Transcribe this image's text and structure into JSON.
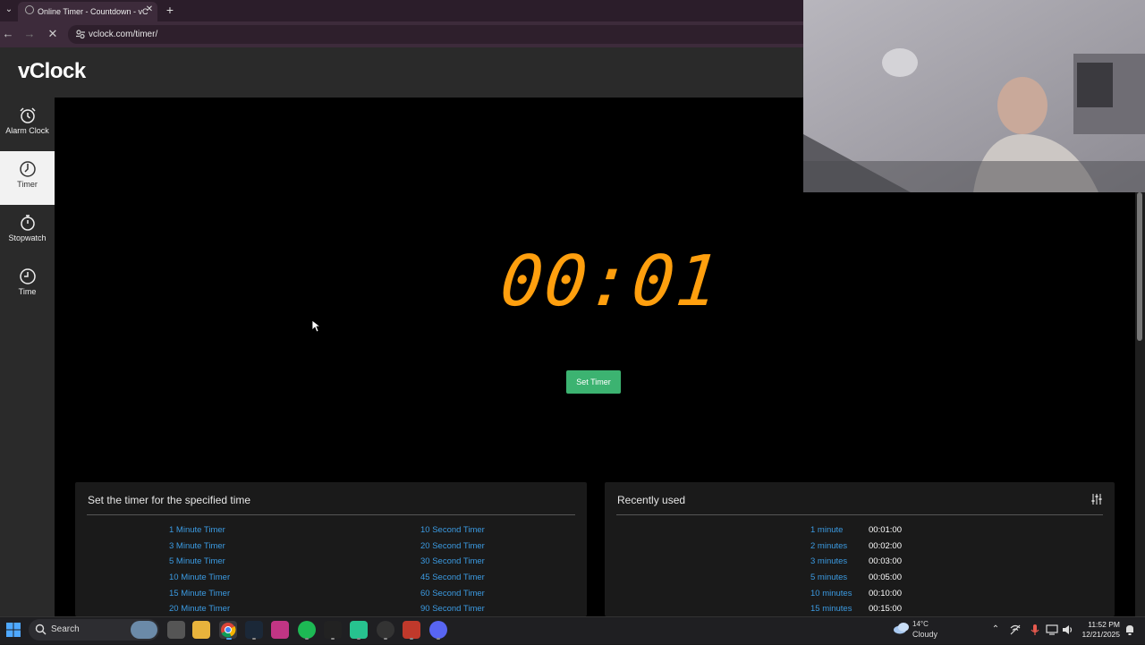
{
  "browser": {
    "tab_title": "Online Timer - Countdown - vC",
    "tab_close": "✕",
    "new_tab": "+",
    "tab_list": "⌄",
    "url": "vclock.com/timer/",
    "back": "←",
    "forward": "→",
    "reload": "✕",
    "site_info": "⚙"
  },
  "site": {
    "logo": "vClock",
    "accent_color": "#ff9f0e"
  },
  "sidebar": {
    "items": [
      {
        "label": "Alarm Clock",
        "icon": "alarm-clock-icon",
        "active": false
      },
      {
        "label": "Timer",
        "icon": "timer-icon",
        "active": true
      },
      {
        "label": "Stopwatch",
        "icon": "stopwatch-icon",
        "active": false
      },
      {
        "label": "Time",
        "icon": "clock-icon",
        "active": false
      }
    ]
  },
  "timer": {
    "display": "00:01",
    "set_button": "Set Timer"
  },
  "presets_panel": {
    "title": "Set the timer for the specified time",
    "minutes": [
      "1 Minute Timer",
      "3 Minute Timer",
      "5 Minute Timer",
      "10 Minute Timer",
      "15 Minute Timer",
      "20 Minute Timer"
    ],
    "seconds": [
      "10 Second Timer",
      "20 Second Timer",
      "30 Second Timer",
      "45 Second Timer",
      "60 Second Timer",
      "90 Second Timer"
    ]
  },
  "recent_panel": {
    "title": "Recently used",
    "settings_icon": "sliders-icon",
    "items": [
      {
        "label": "1 minute",
        "duration": "00:01:00"
      },
      {
        "label": "2 minutes",
        "duration": "00:02:00"
      },
      {
        "label": "3 minutes",
        "duration": "00:03:00"
      },
      {
        "label": "5 minutes",
        "duration": "00:05:00"
      },
      {
        "label": "10 minutes",
        "duration": "00:10:00"
      },
      {
        "label": "15 minutes",
        "duration": "00:15:00"
      }
    ]
  },
  "taskbar": {
    "search_label": "Search",
    "weather_temp": "14°C",
    "weather_desc": "Cloudy",
    "time": "11:52 PM",
    "date": "12/21/2025",
    "tray_chevron": "⌃"
  }
}
